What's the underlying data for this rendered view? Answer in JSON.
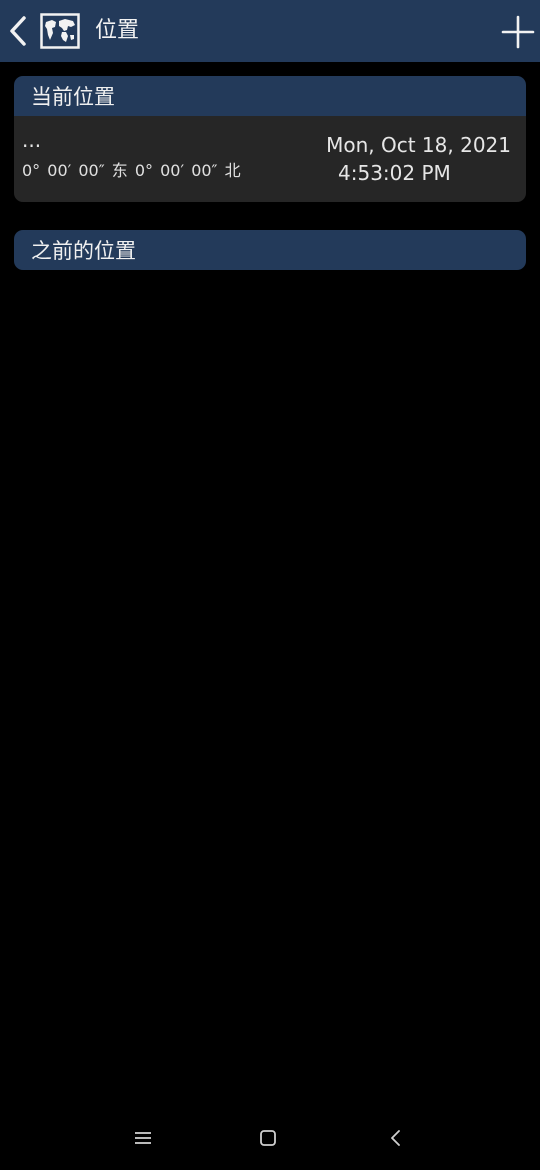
{
  "app_bar": {
    "title": "位置",
    "back_icon": "chevron-left-icon",
    "app_icon": "world-map-icon",
    "action_icon": "plus-icon",
    "background": "#233a5a"
  },
  "current_location": {
    "header": "当前位置",
    "name": "...",
    "coordinates": "0° 00′ 00″ 东  0° 00′ 00″ 北",
    "date": "Mon, Oct 18, 2021",
    "time": "4:53:02 PM"
  },
  "previous_locations": {
    "header": "之前的位置"
  },
  "system_nav": {
    "menu_icon": "menu-icon",
    "home_icon": "home-square-icon",
    "back_icon": "back-chevron-icon"
  }
}
